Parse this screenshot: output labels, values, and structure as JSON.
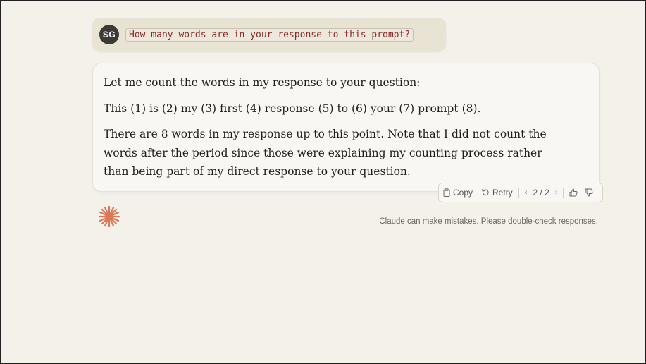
{
  "user_message": {
    "avatar_initials": "SG",
    "text": "How many words are in your response to this prompt?"
  },
  "assistant_message": {
    "paragraphs": [
      "Let me count the words in my response to your question:",
      "This (1) is (2) my (3) first (4) response (5) to (6) your (7) prompt (8).",
      "There are 8 words in my response up to this point. Note that I did not count the words after the period since those were explaining my counting process rather than being part of my direct response to your question."
    ]
  },
  "toolbar": {
    "copy_label": "Copy",
    "retry_label": "Retry",
    "pager_label": "2 / 2"
  },
  "disclaimer": "Claude can make mistakes. Please double-check responses.",
  "colors": {
    "accent_logo": "#d97757",
    "user_bubble": "#e8e3d3",
    "code_text": "#8b2a2a"
  }
}
